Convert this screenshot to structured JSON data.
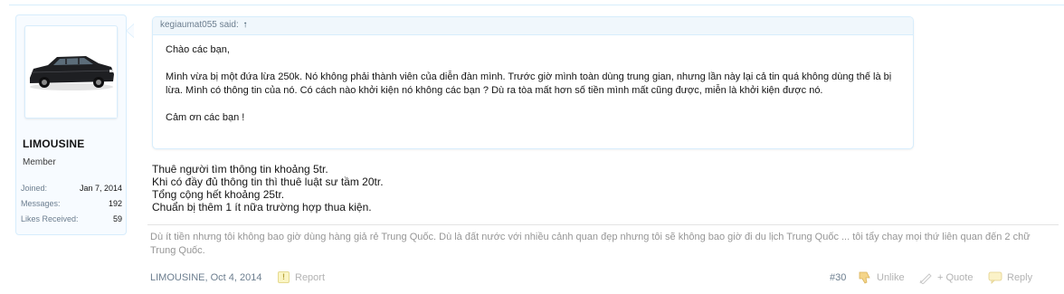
{
  "user": {
    "username": "LIMOUSINE",
    "title": "Member",
    "stats": [
      {
        "label": "Joined:",
        "value": "Jan 7, 2014"
      },
      {
        "label": "Messages:",
        "value": "192"
      },
      {
        "label": "Likes Received:",
        "value": "59"
      }
    ]
  },
  "quote": {
    "author_said": "kegiaumat055 said:",
    "arrow": "↑",
    "paragraphs": [
      "Chào các bạn,",
      "Mình vừa bị một đứa lừa 250k. Nó không phải thành viên của diễn đàn mình. Trước giờ mình toàn dùng trung gian, nhưng lần này lại cả tin quá không dùng thế là bị lừa. Mình có thông tin của nó. Có cách nào khởi kiện nó không các bạn ? Dù ra tòa mất hơn số tiền mình mất cũng được, miễn là khởi kiện được nó.",
      "Cảm ơn các bạn !"
    ]
  },
  "message": {
    "lines": [
      "Thuê người tìm thông tin khoảng 5tr.",
      "Khi có đầy đủ thông tin thì thuê luật sư tầm 20tr.",
      "Tổng cộng hết khoảng 25tr.",
      "Chuẩn bị thêm 1 ít nữa trường hợp thua kiện."
    ]
  },
  "signature": "Dù ít tiền nhưng tôi không bao giờ dùng hàng giả rẻ Trung Quốc. Dù là đất nước với nhiều cảnh quan đẹp nhưng tôi sẽ không bao giờ đi du lịch Trung Quốc ... tôi tẩy chay mọi thứ liên quan đến 2 chữ Trung Quốc.",
  "footer": {
    "author_date": "LIMOUSINE, Oct 4, 2014",
    "report_label": "Report",
    "post_number": "#30",
    "unlike_label": "Unlike",
    "quote_label": "+ Quote",
    "reply_label": "Reply"
  },
  "colors": {
    "border": "#d7edfc",
    "panel_bg": "#f7fbff",
    "muted_text": "#969696"
  },
  "icons": [
    "car-avatar-image",
    "warning-icon",
    "thumbs-down-icon",
    "quote-icon",
    "reply-bubble-icon"
  ]
}
